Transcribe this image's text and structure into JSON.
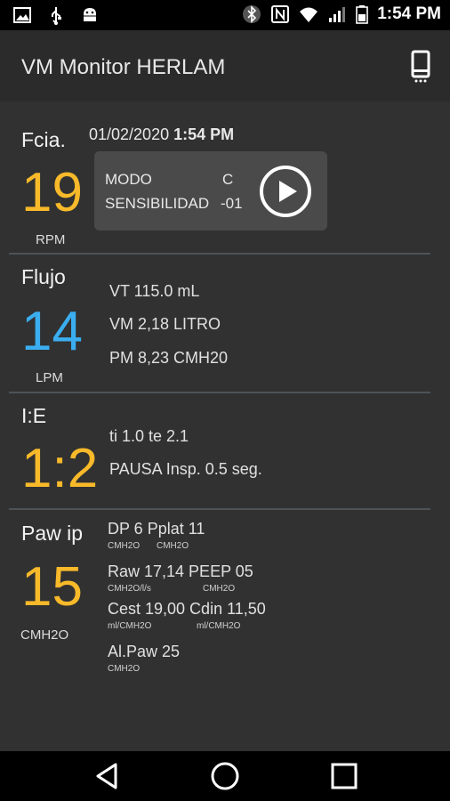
{
  "status_bar": {
    "time": "1:54 PM",
    "left_icons": [
      "image-icon",
      "usb-icon",
      "android-debug-icon"
    ],
    "right_icons": [
      "bluetooth-icon",
      "nfc-icon",
      "wifi-icon",
      "signal-icon",
      "battery-icon"
    ]
  },
  "app_bar": {
    "title": "VM Monitor HERLAM",
    "action_icon": "device-phone-icon"
  },
  "fcia": {
    "label": "Fcia.",
    "value": "19",
    "unit": "RPM",
    "date": "01/02/2020",
    "time": "1:54 PM",
    "mode_label": "MODO",
    "mode_value": "C",
    "sens_label": "SENSIBILIDAD",
    "sens_value": "-01",
    "play_icon": "play-icon"
  },
  "flujo": {
    "label": "Flujo",
    "value": "14",
    "unit": "LPM",
    "vt": "VT  115.0  mL",
    "vm": "VM  2,18  LITRO",
    "pm": "PM  8,23  CMH20"
  },
  "ie": {
    "label": "I:E",
    "value": "1:2",
    "ti_te": "ti  1.0  te  2.1",
    "pausa": "PAUSA Insp.  0.5  seg."
  },
  "paw": {
    "label": "Paw ip",
    "value": "15",
    "unit": "CMH2O",
    "dp_line": "DP 6 Pplat 11",
    "dp_sub1": "CMH2O",
    "dp_sub2": "CMH2O",
    "raw_line": "Raw 17,14 PEEP 05",
    "raw_sub1": "CMH2O/l/s",
    "raw_sub2": "CMH2O",
    "cest_line": "Cest 19,00 Cdin 11,50",
    "cest_sub1": "ml/CMH2O",
    "cest_sub2": "ml/CMH2O",
    "alpaw_line": "Al.Paw 25",
    "alpaw_sub": "CMH2O"
  },
  "nav_bar": {
    "icons": [
      "back-icon",
      "home-icon",
      "recents-icon"
    ]
  },
  "colors": {
    "yellow": "#f8b92a",
    "blue": "#3aaef0",
    "green": "#9cc23a",
    "background": "#313131",
    "app_bar": "#2b2b2b"
  }
}
